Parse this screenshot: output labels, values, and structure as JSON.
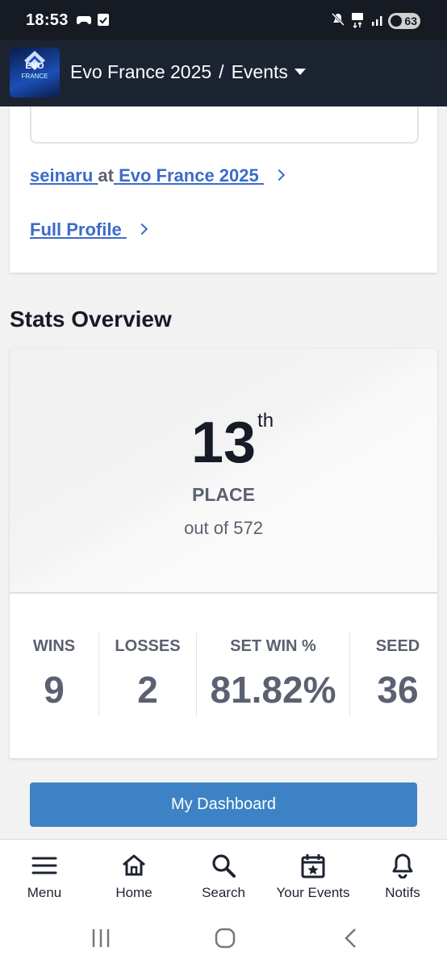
{
  "status": {
    "time": "18:53",
    "battery": "63"
  },
  "appbar": {
    "logo_text": "EVO",
    "logo_sub": "FRANCE",
    "event": "Evo France 2025",
    "separator": "/",
    "section": "Events"
  },
  "profile": {
    "player": "seinaru",
    "at": "at",
    "event_link": "Evo France 2025",
    "full_profile": "Full Profile"
  },
  "stats": {
    "title": "Stats Overview",
    "place_number": "13",
    "place_suffix": "th",
    "place_label": "PLACE",
    "out_of": "out of 572",
    "columns": [
      {
        "label": "WINS",
        "value": "9"
      },
      {
        "label": "LOSSES",
        "value": "2"
      },
      {
        "label": "SET WIN %",
        "value": "81.82%"
      },
      {
        "label": "SEED",
        "value": "36"
      }
    ]
  },
  "dashboard_button": "My Dashboard",
  "bottom_nav": [
    {
      "label": "Menu",
      "icon": "menu-icon"
    },
    {
      "label": "Home",
      "icon": "home-icon"
    },
    {
      "label": "Search",
      "icon": "search-icon"
    },
    {
      "label": "Your Events",
      "icon": "calendar-star-icon"
    },
    {
      "label": "Notifs",
      "icon": "bell-icon"
    }
  ],
  "colors": {
    "link": "#3c6bc8",
    "button": "#3d82c4",
    "appbar": "#1c2331"
  }
}
